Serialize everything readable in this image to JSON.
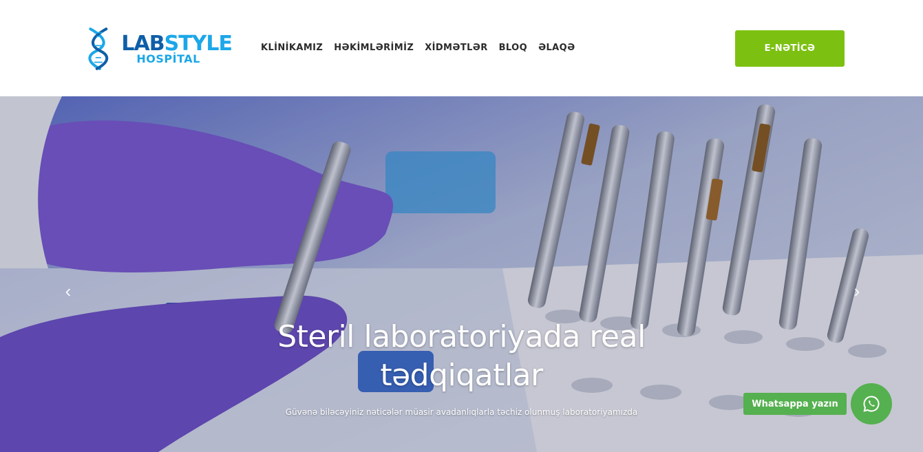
{
  "header": {
    "logo": {
      "line1_a": "LAB",
      "line1_b": "STYLE",
      "line2": "HOSPİTAL"
    },
    "nav": [
      "KLİNİKAMIZ",
      "HƏKİMLƏRİMİZ",
      "XİDMƏTLƏR",
      "BLOQ",
      "ƏLAQƏ"
    ],
    "cta_label": "E-NƏTİCƏ"
  },
  "hero": {
    "title": "Steril laboratoriyada real tədqiqatlar",
    "subtitle": "Güvənə biləcəyiniz nəticələr müasir avadanlıqlarla təchiz olunmuş laboratoriyamızda",
    "prev_icon": "chevron-left-icon",
    "next_icon": "chevron-right-icon"
  },
  "whatsapp": {
    "label": "Whatsappa yazın",
    "icon": "whatsapp-icon"
  },
  "colors": {
    "accent_green": "#7cc111",
    "whatsapp_green": "#55b04f",
    "logo_dark": "#0f5fa8",
    "logo_light": "#1ca7e8"
  }
}
